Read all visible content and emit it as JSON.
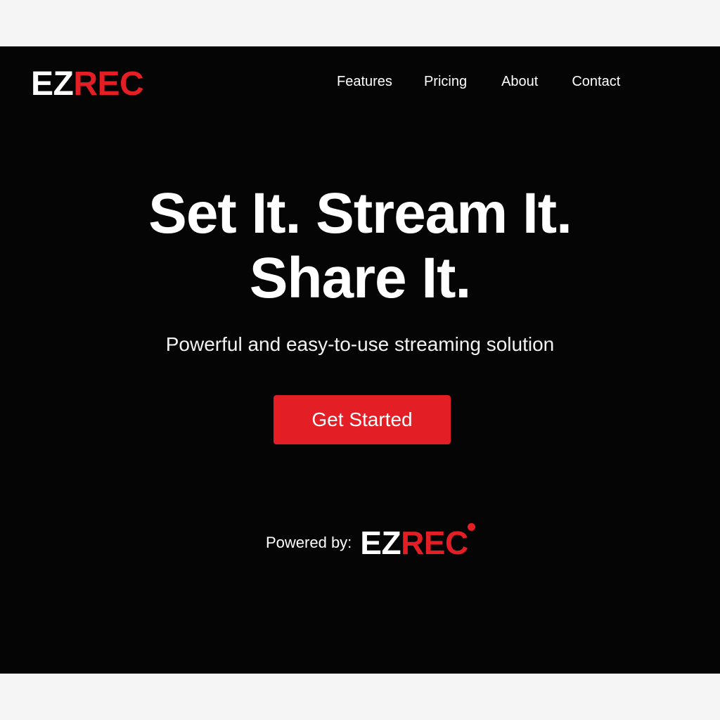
{
  "header": {
    "logo_part1": "EZ",
    "logo_part2": "REC",
    "nav": [
      {
        "label": "Features"
      },
      {
        "label": "Pricing"
      },
      {
        "label": "About"
      },
      {
        "label": "Contact"
      }
    ]
  },
  "hero": {
    "headline_line1": "Set It. Stream It.",
    "headline_line2": "Share It.",
    "subtitle": "Powerful and easy-to-use streaming solution",
    "cta_label": "Get Started"
  },
  "footer": {
    "powered_label": "Powered by:",
    "brand_part1": "EZ",
    "brand_part2": "REC",
    "record_icon": "record-dot-icon"
  },
  "colors": {
    "background": "#050505",
    "accent": "#e31e24",
    "text": "#ffffff",
    "page": "#f5f5f5"
  }
}
